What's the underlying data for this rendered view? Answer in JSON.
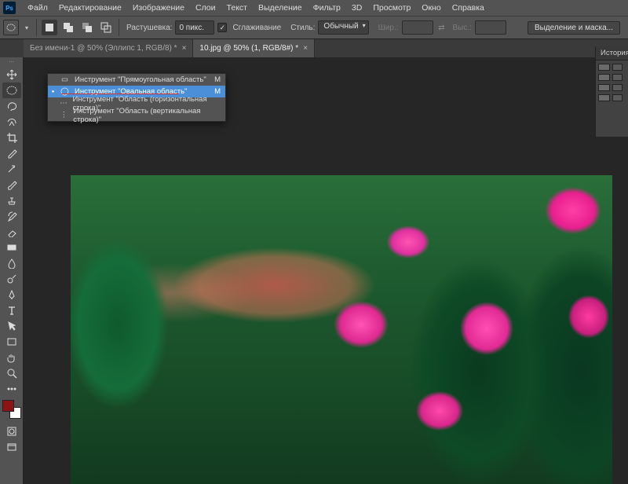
{
  "app": {
    "badge": "Ps"
  },
  "menu": [
    "Файл",
    "Редактирование",
    "Изображение",
    "Слои",
    "Текст",
    "Выделение",
    "Фильтр",
    "3D",
    "Просмотр",
    "Окно",
    "Справка"
  ],
  "options": {
    "feather_label": "Растушевка:",
    "feather_value": "0 пикс.",
    "antialias_label": "Сглаживание",
    "antialias_checked": true,
    "style_label": "Стиль:",
    "style_value": "Обычный",
    "width_label": "Шир.:",
    "width_value": "",
    "height_label": "Выс.:",
    "height_value": "",
    "select_mask": "Выделение и маска..."
  },
  "tabs": [
    {
      "label": "Без имени-1 @ 50% (Эллипс 1, RGB/8) *",
      "active": false
    },
    {
      "label": "10.jpg @ 50% (1, RGB/8#) *",
      "active": true
    }
  ],
  "flyout": {
    "items": [
      {
        "name": "Инструмент \"Прямоугольная область\"",
        "shortcut": "M",
        "icon": "rect",
        "current": false
      },
      {
        "name": "Инструмент \"Овальная область\"",
        "shortcut": "M",
        "icon": "ellipse",
        "current": true,
        "highlighted": true
      },
      {
        "name": "Инструмент \"Область (горизонтальная строка)\"",
        "shortcut": "",
        "icon": "hrow",
        "current": false
      },
      {
        "name": "Инструмент \"Область (вертикальная строка)\"",
        "shortcut": "",
        "icon": "vrow",
        "current": false
      }
    ]
  },
  "history_panel": {
    "title": "История",
    "rows": 4
  },
  "colors": {
    "fg": "#8b1515",
    "bg": "#ffffff"
  }
}
